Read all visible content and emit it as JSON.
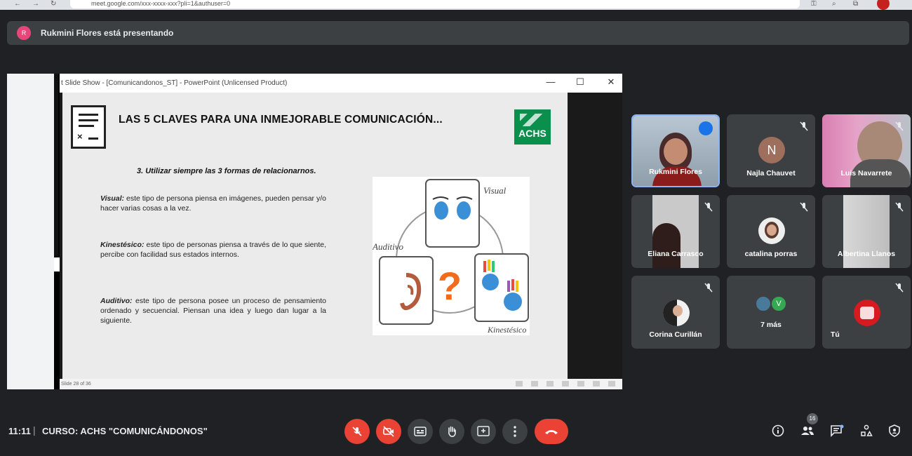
{
  "browser": {
    "url": "meet.google.com/xxx-xxxx-xxx?pli=1&authuser=0"
  },
  "banner": {
    "avatar_letter": "R",
    "text": "Rukmini Flores está presentando"
  },
  "powerpoint": {
    "window_title": "t Slide Show - [Comunicandonos_ST] - PowerPoint (Unlicensed Product)",
    "status_text": "Slide 28 of 36"
  },
  "slide": {
    "heading": "LAS 5 CLAVES PARA UNA INMEJORABLE COMUNICACIÓN...",
    "logo_text": "ACHS",
    "subheading": "3. Utilizar siempre las 3 formas de relacionarnos.",
    "paragraphs": [
      {
        "term": "Visual:",
        "text": " este tipo de persona piensa en imágenes, pueden pensar y/o hacer varias cosas a la vez."
      },
      {
        "term": "Kinestésico:",
        "text": " este tipo de personas piensa a través de lo que siente, percibe con facilidad sus estados internos."
      },
      {
        "term": "Auditivo:",
        "text": " este tipo de persona posee un proceso de pensamiento ordenado y secuencial. Piensan una idea y luego dan lugar a la siguiente."
      }
    ],
    "image_labels": {
      "visual": "Visual",
      "auditivo": "Auditivo",
      "kinestesico": "Kinestésico",
      "question": "?"
    }
  },
  "participants": [
    {
      "name": "Rukmini Flores",
      "type": "video"
    },
    {
      "name": "Najla Chauvet",
      "type": "letter",
      "letter": "N",
      "color": "#9e6f5c"
    },
    {
      "name": "Luis Navarrete",
      "type": "video"
    },
    {
      "name": "Eliana Carrasco",
      "type": "video"
    },
    {
      "name": "catalina porras",
      "type": "photo"
    },
    {
      "name": "Albertina Llanos",
      "type": "video"
    },
    {
      "name": "Corina Curillán",
      "type": "photo"
    },
    {
      "name": "7 más",
      "type": "group",
      "letter": "V"
    },
    {
      "name": "Tú",
      "type": "photo"
    }
  ],
  "bottom": {
    "time": "11:11",
    "separator": "|",
    "title": "CURSO: ACHS \"COMUNICÁNDONOS\"",
    "people_count": "16"
  },
  "colors": {
    "meet_bg": "#202124",
    "tile_bg": "#3c4043",
    "danger": "#ea4335",
    "achs_green": "#0b8f4d"
  }
}
